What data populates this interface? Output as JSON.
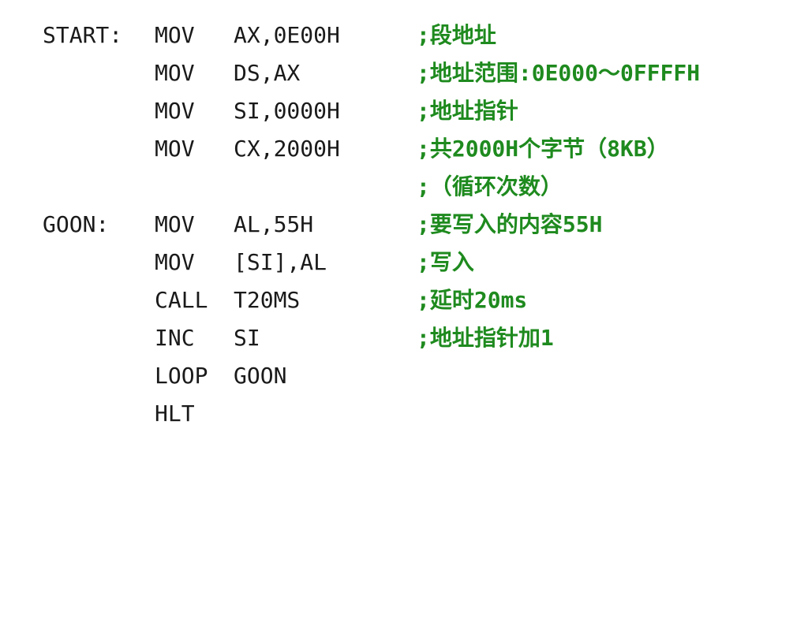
{
  "lines": [
    {
      "label": "START:",
      "op": "MOV",
      "args": "AX,0E00H",
      "comment": ";段地址"
    },
    {
      "label": "",
      "op": "MOV",
      "args": "DS,AX",
      "comment": ";地址范围:0E000～0FFFFH"
    },
    {
      "label": "",
      "op": "MOV",
      "args": "SI,0000H",
      "comment": ";地址指针"
    },
    {
      "label": "",
      "op": "MOV",
      "args": "CX,2000H",
      "comment": ";共2000H个字节（8KB）"
    },
    {
      "label": "",
      "op": "",
      "args": "",
      "comment": ";（循环次数）"
    },
    {
      "label": "GOON:",
      "op": "MOV",
      "args": "AL,55H",
      "comment": ";要写入的内容55H"
    },
    {
      "label": "",
      "op": "MOV",
      "args": "[SI],AL",
      "comment": ";写入"
    },
    {
      "label": "",
      "op": "CALL",
      "args": "T20MS",
      "comment": ";延时20ms"
    },
    {
      "label": "",
      "op": "INC",
      "args": "SI",
      "comment": ";地址指针加1"
    },
    {
      "label": "",
      "op": "LOOP",
      "args": "GOON",
      "comment": ""
    },
    {
      "label": "",
      "op": "HLT",
      "args": "",
      "comment": ""
    }
  ],
  "colors": {
    "code": "#1a1a1a",
    "comment": "#1e8a1e",
    "background": "#ffffff"
  }
}
